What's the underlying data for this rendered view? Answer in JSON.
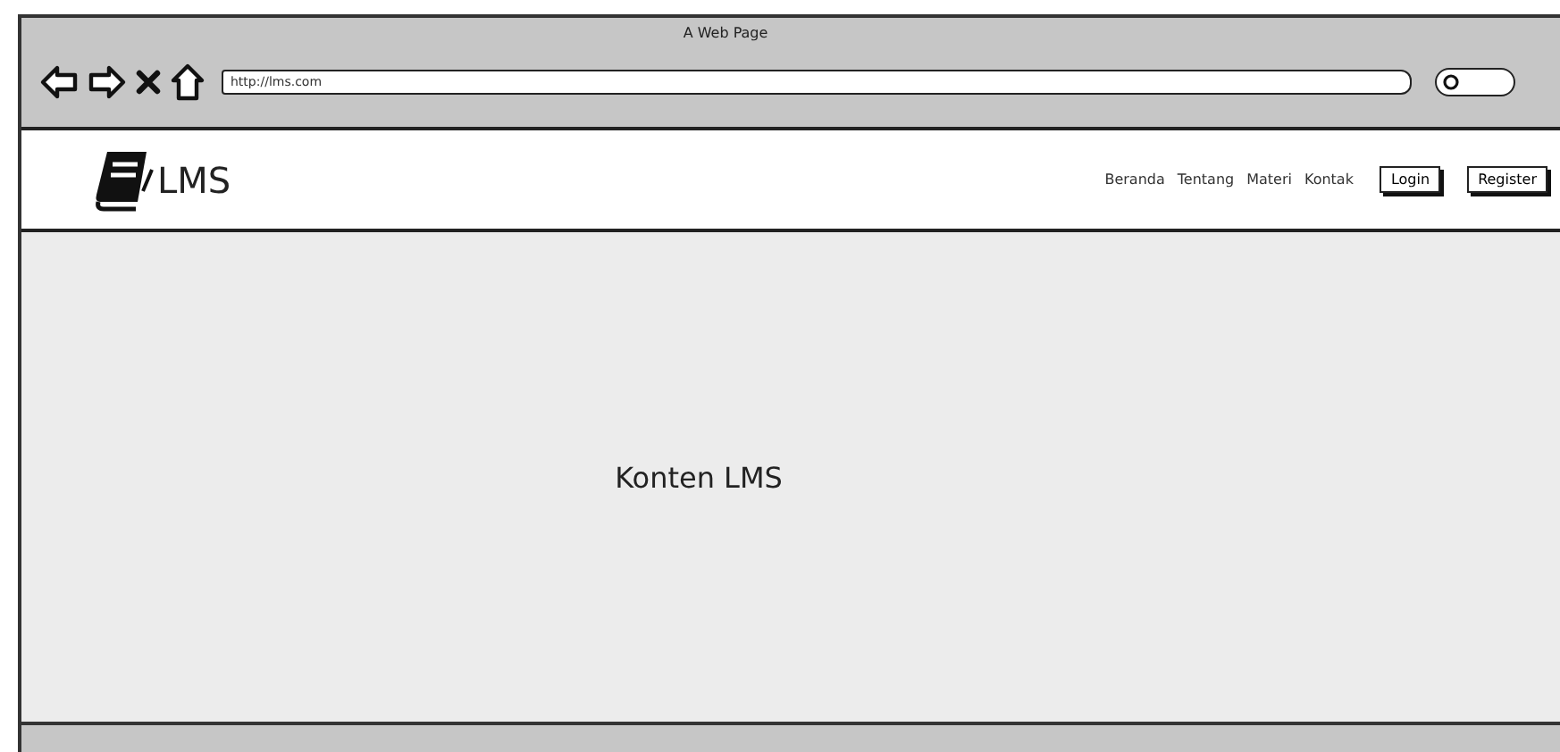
{
  "window": {
    "title": "A Web Page"
  },
  "address_bar": {
    "value": "http://lms.com"
  },
  "header": {
    "logo_text": "LMS",
    "nav_links": [
      {
        "label": "Beranda"
      },
      {
        "label": "Tentang"
      },
      {
        "label": "Materi"
      },
      {
        "label": "Kontak"
      }
    ],
    "buttons": [
      "Login",
      "Register"
    ]
  },
  "content": {
    "text": "Konten LMS"
  }
}
